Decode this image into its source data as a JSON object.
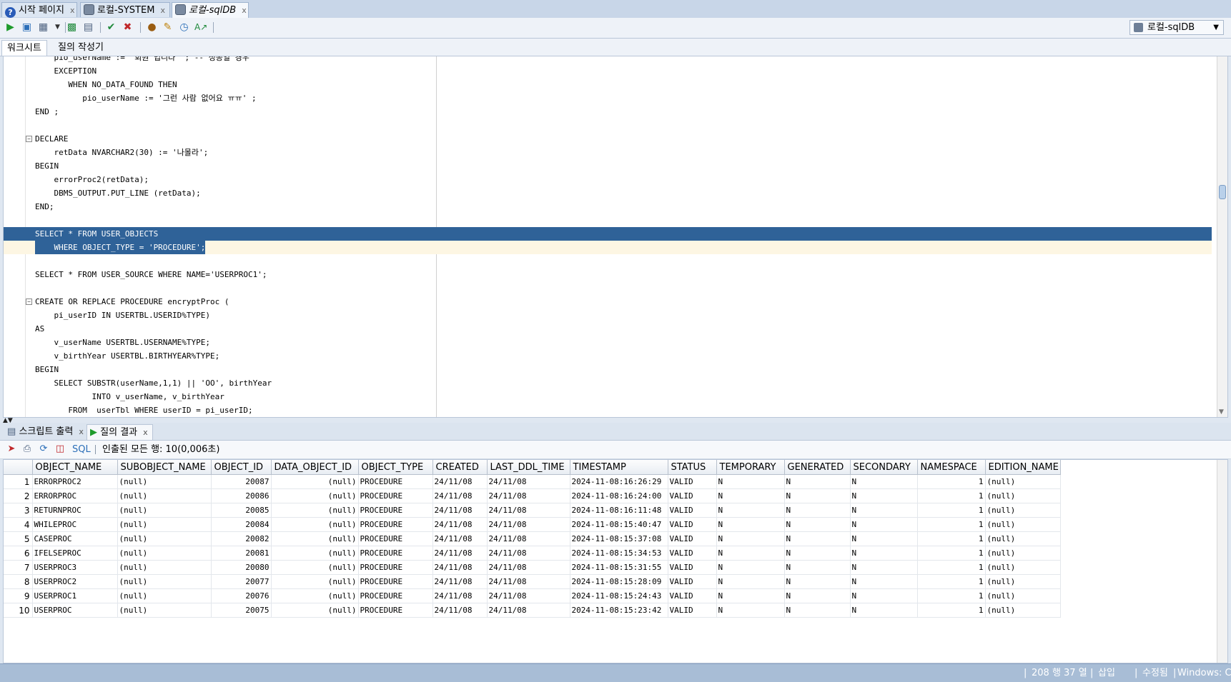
{
  "tabs": [
    {
      "icon": "help-icon",
      "label": "시작 페이지",
      "close": "x"
    },
    {
      "icon": "database-connection-icon",
      "label": "로컬-SYSTEM",
      "close": "x"
    },
    {
      "icon": "database-connection-icon",
      "label": "로컬-sqlDB",
      "close": "x"
    }
  ],
  "toolbar": {
    "connection_value": "로컬-sqlDB"
  },
  "subtabs": [
    "워크시트",
    "질의 작성기"
  ],
  "editor_lines": [
    "    pio_userName := '회원 입니다' ; -- 성공일 경우",
    "    EXCEPTION",
    "       WHEN NO_DATA_FOUND THEN",
    "          pio_userName := '그런 사람 없어요 ㅠㅠ' ;",
    "END ;",
    "",
    "DECLARE",
    "    retData NVARCHAR2(30) := '나몰라';",
    "BEGIN",
    "    errorProc2(retData);",
    "    DBMS_OUTPUT.PUT_LINE (retData);",
    "END;",
    "",
    "SELECT * FROM USER_OBJECTS",
    "    WHERE OBJECT_TYPE = 'PROCEDURE';",
    "",
    "SELECT * FROM USER_SOURCE WHERE NAME='USERPROC1';",
    "",
    "CREATE OR REPLACE PROCEDURE encryptProc (",
    "    pi_userID IN USERTBL.USERID%TYPE)",
    "AS",
    "    v_userName USERTBL.USERNAME%TYPE;",
    "    v_birthYear USERTBL.BIRTHYEAR%TYPE;",
    "BEGIN",
    "    SELECT SUBSTR(userName,1,1) || 'OO', birthYear",
    "            INTO v_userName, v_birthYear",
    "       FROM  userTbl WHERE userID = pi_userID;"
  ],
  "result_tabs": [
    {
      "label": "스크립트 출력",
      "close": "x"
    },
    {
      "label": "질의 결과",
      "close": "x"
    }
  ],
  "result_toolbar": {
    "sql_label": "SQL",
    "fetch_status": "인출된 모든 행: 10(0,006초)"
  },
  "result_table": {
    "columns": [
      "OBJECT_NAME",
      "SUBOBJECT_NAME",
      "OBJECT_ID",
      "DATA_OBJECT_ID",
      "OBJECT_TYPE",
      "CREATED",
      "LAST_DDL_TIME",
      "TIMESTAMP",
      "STATUS",
      "TEMPORARY",
      "GENERATED",
      "SECONDARY",
      "NAMESPACE",
      "EDITION_NAME"
    ],
    "rows": [
      [
        "1",
        "ERRORPROC2",
        "(null)",
        "20087",
        "(null)",
        "PROCEDURE",
        "24/11/08",
        "24/11/08",
        "2024-11-08:16:26:29",
        "VALID",
        "N",
        "N",
        "N",
        "1",
        "(null)"
      ],
      [
        "2",
        "ERRORPROC",
        "(null)",
        "20086",
        "(null)",
        "PROCEDURE",
        "24/11/08",
        "24/11/08",
        "2024-11-08:16:24:00",
        "VALID",
        "N",
        "N",
        "N",
        "1",
        "(null)"
      ],
      [
        "3",
        "RETURNPROC",
        "(null)",
        "20085",
        "(null)",
        "PROCEDURE",
        "24/11/08",
        "24/11/08",
        "2024-11-08:16:11:48",
        "VALID",
        "N",
        "N",
        "N",
        "1",
        "(null)"
      ],
      [
        "4",
        "WHILEPROC",
        "(null)",
        "20084",
        "(null)",
        "PROCEDURE",
        "24/11/08",
        "24/11/08",
        "2024-11-08:15:40:47",
        "VALID",
        "N",
        "N",
        "N",
        "1",
        "(null)"
      ],
      [
        "5",
        "CASEPROC",
        "(null)",
        "20082",
        "(null)",
        "PROCEDURE",
        "24/11/08",
        "24/11/08",
        "2024-11-08:15:37:08",
        "VALID",
        "N",
        "N",
        "N",
        "1",
        "(null)"
      ],
      [
        "6",
        "IFELSEPROC",
        "(null)",
        "20081",
        "(null)",
        "PROCEDURE",
        "24/11/08",
        "24/11/08",
        "2024-11-08:15:34:53",
        "VALID",
        "N",
        "N",
        "N",
        "1",
        "(null)"
      ],
      [
        "7",
        "USERPROC3",
        "(null)",
        "20080",
        "(null)",
        "PROCEDURE",
        "24/11/08",
        "24/11/08",
        "2024-11-08:15:31:55",
        "VALID",
        "N",
        "N",
        "N",
        "1",
        "(null)"
      ],
      [
        "8",
        "USERPROC2",
        "(null)",
        "20077",
        "(null)",
        "PROCEDURE",
        "24/11/08",
        "24/11/08",
        "2024-11-08:15:28:09",
        "VALID",
        "N",
        "N",
        "N",
        "1",
        "(null)"
      ],
      [
        "9",
        "USERPROC1",
        "(null)",
        "20076",
        "(null)",
        "PROCEDURE",
        "24/11/08",
        "24/11/08",
        "2024-11-08:15:24:43",
        "VALID",
        "N",
        "N",
        "N",
        "1",
        "(null)"
      ],
      [
        "10",
        "USERPROC",
        "(null)",
        "20075",
        "(null)",
        "PROCEDURE",
        "24/11/08",
        "24/11/08",
        "2024-11-08:15:23:42",
        "VALID",
        "N",
        "N",
        "N",
        "1",
        "(null)"
      ]
    ]
  },
  "status_bar": {
    "position": "208 행 37 열",
    "mode": "삽입",
    "modified": "수정됨",
    "line_ending": "Windows: CR"
  },
  "colors": {
    "selection": "#2f6298",
    "current_line": "#fdf6e3",
    "keyword": "#1f3b9e",
    "status_bar": "#a8bdd6"
  }
}
